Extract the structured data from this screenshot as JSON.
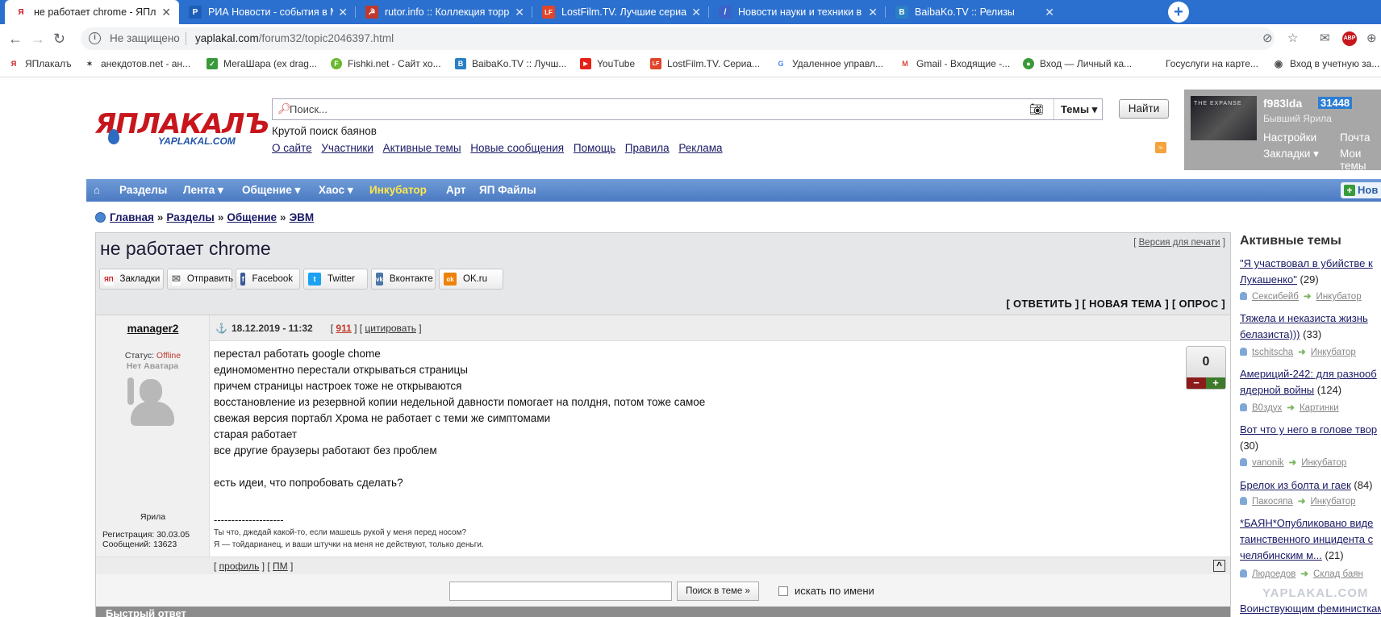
{
  "browser": {
    "tabs": [
      {
        "title": "не работает chrome - ЯПлакалъ",
        "favicon": "yaplakal-icon",
        "color": "#c8161d",
        "glyph": "Я"
      },
      {
        "title": "РИА Новости - события в Моск",
        "favicon": "ria-icon",
        "color": "#1d5fb8",
        "glyph": "Р"
      },
      {
        "title": "rutor.info :: Коллекция торрент",
        "favicon": "rutor-icon",
        "color": "#c0392b",
        "glyph": "☭"
      },
      {
        "title": "LostFilm.TV. Лучшие сериалы. О",
        "favicon": "lostfilm-icon",
        "color": "#e0452b",
        "glyph": "LF"
      },
      {
        "title": "Новости науки и техники в Рос",
        "favicon": "science-news-icon",
        "color": "#3a63c8",
        "glyph": "/"
      },
      {
        "title": "BaibaKo.TV :: Релизы",
        "favicon": "baibako-icon",
        "color": "#2b7fc4",
        "glyph": "B"
      }
    ],
    "address": {
      "security": "Не защищено",
      "host": "yaplakal.com",
      "path": "/forum32/topic2046397.html"
    },
    "bookmarks": [
      {
        "label": "ЯПлакалъ",
        "color": "#c8161d",
        "glyph": "Я"
      },
      {
        "label": "анекдотов.net - ан...",
        "color": "#333333",
        "glyph": "🐞"
      },
      {
        "label": "МегаШара (ex drag...",
        "color": "#3a9a3a",
        "glyph": "✓"
      },
      {
        "label": "Fishki.net - Сайт хо...",
        "color": "#6ab82e",
        "glyph": "F"
      },
      {
        "label": "BaibaKo.TV :: Лучш...",
        "color": "#2b7fc4",
        "glyph": "B"
      },
      {
        "label": "YouTube",
        "color": "#e62117",
        "glyph": "▶"
      },
      {
        "label": "LostFilm.TV. Сериа...",
        "color": "#e0452b",
        "glyph": "LF"
      },
      {
        "label": "Удаленное управл...",
        "color": "#4285f4",
        "glyph": "G"
      },
      {
        "label": "Gmail - Входящие -...",
        "color": "#d44638",
        "glyph": "M"
      },
      {
        "label": "Вход — Личный ка...",
        "color": "#3a9a3a",
        "glyph": "●"
      },
      {
        "label": "Госуслуги на карте...",
        "color": "#ffffff",
        "glyph": ""
      },
      {
        "label": "Вход в учетную за...",
        "color": "#555555",
        "glyph": "◉"
      }
    ]
  },
  "site": {
    "logo_big": "ЯПЛАКАЛЪ",
    "logo_small": "YAPLAKAL.COM",
    "search": {
      "placeholder": "Поиск...",
      "topics_label": "Темы",
      "button": "Найти"
    },
    "tagline": "Крутой поиск баянов",
    "toplinks": [
      "О сайте",
      "Участники",
      "Активные темы",
      "Новые сообщения",
      "Помощь",
      "Правила",
      "Реклама"
    ],
    "user": {
      "name": "f983lda",
      "points": "31448",
      "rank": "Бывший Ярила",
      "avatar_text": "THE EXPANSE",
      "links": [
        "Настройки",
        "Почта",
        "Закладки ▾",
        "Мои темы"
      ]
    },
    "nav": [
      {
        "label": "Разделы"
      },
      {
        "label": "Лента ▾"
      },
      {
        "label": "Общение ▾"
      },
      {
        "label": "Хаос ▾"
      },
      {
        "label": "Инкубатор",
        "highlight": true
      },
      {
        "label": "Арт"
      },
      {
        "label": "ЯП Файлы"
      }
    ],
    "new_button": "Нов",
    "breadcrumb": [
      "Главная",
      "Разделы",
      "Общение",
      "ЭВМ"
    ]
  },
  "topic": {
    "title": "не работает chrome",
    "print_link": "Версия для печати",
    "share": [
      {
        "label": "Закладки",
        "color": "#c8161d",
        "glyph": "ЯП"
      },
      {
        "label": "Отправить",
        "color": "#888888",
        "glyph": "✉"
      },
      {
        "label": "Facebook",
        "color": "#3b5998",
        "glyph": "f"
      },
      {
        "label": "Twitter",
        "color": "#1da1f2",
        "glyph": "t"
      },
      {
        "label": "Вконтакте",
        "color": "#4a76a8",
        "glyph": "vk"
      },
      {
        "label": "OK.ru",
        "color": "#ee8208",
        "glyph": "ok"
      }
    ],
    "actions": "[ ОТВЕТИТЬ ] [ НОВАЯ ТЕМА ] [ ОПРОС ]"
  },
  "post": {
    "author": "manager2",
    "status_label": "Статус:",
    "status_value": "Offline",
    "no_avatar": "Нет Аватара",
    "rank": "Ярила",
    "registration": "Регистрация: 30.03.05",
    "messages": "Сообщений: 13623",
    "date": "18.12.2019 - 11:32",
    "number": "911",
    "quote": "цитировать",
    "lines": [
      "перестал работать google chome",
      "единомоментно перестали открываться страницы",
      "причем страницы настроек тоже не открываются",
      "восстановление из резервной копии недельной давности помогает на полдня, потом тоже самое",
      "свежая версия портабл Хрома не работает с теми же симптомами",
      "старая работает",
      "все другие браузеры работают без проблем",
      "",
      "есть идеи, что попробовать сделать?"
    ],
    "sig_line": "--------------------",
    "signature": [
      "Ты что, джедай какой-то, если машешь рукой у меня перед носом?",
      "Я — тойдарианец, и ваши штучки на меня не действуют, только деньги."
    ],
    "rating": "0",
    "profile_link": "профиль",
    "pm_link": "ПМ",
    "up": "^"
  },
  "topic_search": {
    "button": "Поиск в теме »",
    "checkbox_label": "искать по имени"
  },
  "quick_reply": "Быстрый ответ",
  "sidebar": {
    "title": "Активные темы",
    "items": [
      {
        "title": "\"Я участвовал в убийстве к",
        "title2": "Лукашенко\"",
        "count": "(29)",
        "user": "Сексибейб",
        "section": "Инкубатор"
      },
      {
        "title": "Тяжела и неказиста жизнь",
        "title2": "белазиста)))",
        "count": "(33)",
        "user": "tschitscha",
        "section": "Инкубатор"
      },
      {
        "title": "Америций-242: для разнооб",
        "title2": "ядерной войны",
        "count": "(124)",
        "user": "B0здух",
        "section": "Картинки"
      },
      {
        "title": "Вот что у него в голове твор",
        "title2": "",
        "count": "(30)",
        "user": "vanonik",
        "section": "Инкубатор"
      },
      {
        "title": "Брелок из болта и гаек",
        "title2": "",
        "count": "(84)",
        "user": "Пакосяпа",
        "section": "Инкубатор"
      },
      {
        "title": "*БАЯН*Опубликовано виде",
        "title2": "таинственного инцидента с",
        "title3": "челябинским м...",
        "count": "(21)",
        "user": "Людоедов",
        "section": "Склад баян"
      },
      {
        "title": "Воинствующим феминисткам",
        "title2": "",
        "count": "",
        "user": "",
        "section": ""
      }
    ],
    "watermark": "YAPLAKAL.COM"
  }
}
